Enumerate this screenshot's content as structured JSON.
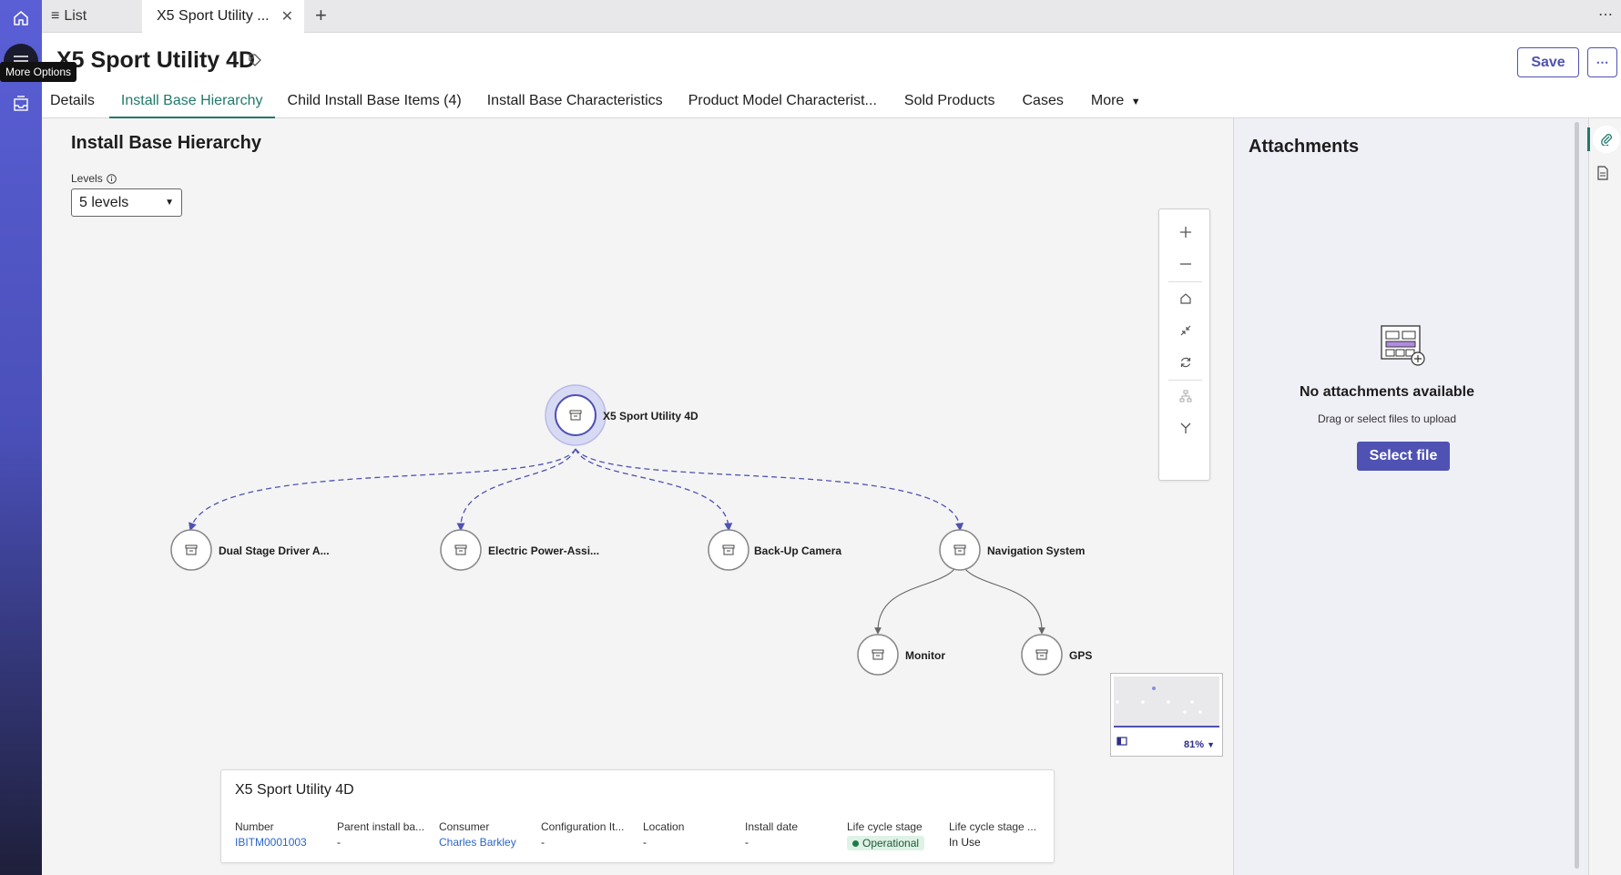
{
  "rail": {
    "tooltip": "More Options"
  },
  "tabbar": {
    "list_label": "List",
    "active_tab": "X5 Sport Utility ...",
    "more": "⋯"
  },
  "header": {
    "title": "X5 Sport Utility 4D",
    "save_label": "Save",
    "more_label": "⋯",
    "tabs": [
      {
        "label": "Details"
      },
      {
        "label": "Install Base Hierarchy",
        "active": true
      },
      {
        "label": "Child Install Base Items (4)"
      },
      {
        "label": "Install Base Characteristics"
      },
      {
        "label": "Product Model Characterist..."
      },
      {
        "label": "Sold Products"
      },
      {
        "label": "Cases"
      },
      {
        "label": "More"
      }
    ]
  },
  "hierarchy": {
    "title": "Install Base Hierarchy",
    "levels_label": "Levels",
    "levels_value": "5 levels",
    "nodes": {
      "root": "X5 Sport Utility 4D",
      "child1": "Dual Stage Driver A...",
      "child2": "Electric Power-Assi...",
      "child3": "Back-Up Camera",
      "child4": "Navigation System",
      "grandchild1": "Monitor",
      "grandchild2": "GPS"
    },
    "minimap_zoom": "81%"
  },
  "card": {
    "title": "X5 Sport Utility 4D",
    "fields": [
      {
        "label": "Number",
        "value": "IBITM0001003",
        "link": true
      },
      {
        "label": "Parent install ba...",
        "value": "-"
      },
      {
        "label": "Consumer",
        "value": "Charles Barkley",
        "link": true
      },
      {
        "label": "Configuration It...",
        "value": "-"
      },
      {
        "label": "Location",
        "value": "-"
      },
      {
        "label": "Install date",
        "value": "-"
      },
      {
        "label": "Life cycle stage",
        "value": "Operational",
        "pill": true
      },
      {
        "label": "Life cycle stage ...",
        "value": "In Use"
      }
    ]
  },
  "attachments": {
    "title": "Attachments",
    "empty_title": "No attachments available",
    "empty_sub": "Drag or select files to upload",
    "select_label": "Select file"
  },
  "colors": {
    "accent": "#4f52b2",
    "active_tab": "#207a6a",
    "edge": "#4f52b2"
  }
}
